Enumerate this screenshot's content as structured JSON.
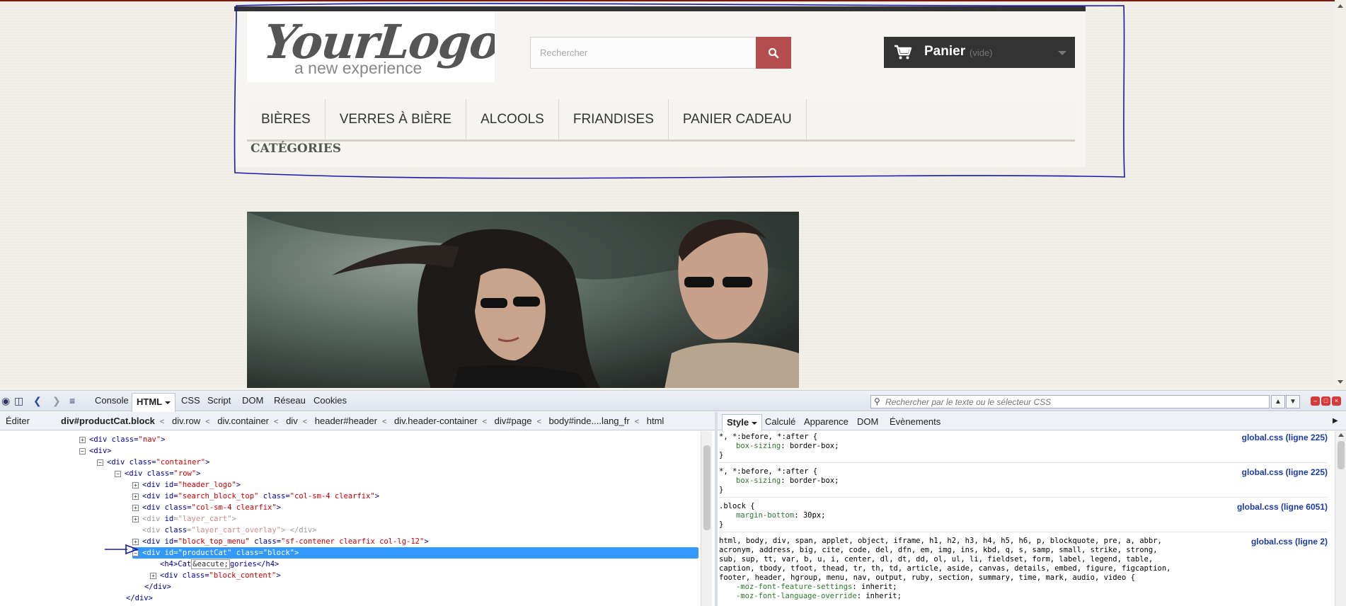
{
  "site": {
    "logo_main": "YourLogo",
    "logo_tagline": "a new experience",
    "search_placeholder": "Rechercher",
    "cart_label": "Panier",
    "cart_status": "(vide)",
    "menu": [
      "BIÈRES",
      "VERRES À BIÈRE",
      "ALCOOLS",
      "FRIANDISES",
      "PANIER CADEAU"
    ],
    "categories_title": "CATÉGORIES"
  },
  "colors": {
    "search_button": "#b44d4d",
    "cart_bg": "#333333",
    "selection": "#3399ff",
    "annotation": "#1a1aa8"
  },
  "devtools": {
    "tabs": [
      "Console",
      "HTML",
      "CSS",
      "Script",
      "DOM",
      "Réseau",
      "Cookies"
    ],
    "active_tab": "HTML",
    "css_search_placeholder": "Rechercher par le texte ou le sélecteur CSS",
    "edit_label": "Éditer",
    "breadcrumbs": [
      "div#productCat.block",
      "div.row",
      "div.container",
      "div",
      "header#header",
      "div.header-container",
      "div#page",
      "body#inde....lang_fr",
      "html"
    ],
    "style_tabs": [
      "Style",
      "Calculé",
      "Apparence",
      "DOM",
      "Évènements"
    ],
    "html_lines": [
      {
        "t1": "<div ",
        "a": "class",
        "v": "\"nav\"",
        "t2": ">"
      },
      {
        "t1": "<div>",
        "a": "",
        "v": "",
        "t2": ""
      },
      {
        "t1": "<div ",
        "a": "class",
        "v": "\"container\"",
        "t2": ">"
      },
      {
        "t1": "<div ",
        "a": "class",
        "v": "\"row\"",
        "t2": ">"
      },
      {
        "t1": "<div ",
        "a": "id",
        "v": "\"header_logo\"",
        "t2": ">"
      },
      {
        "t1": "<div ",
        "a": "id",
        "v": "\"search_block_top\"",
        "t2": "",
        "a2": "class",
        "v2": "\"col-sm-4 clearfix\"",
        "t3": ">"
      },
      {
        "t1": "<div ",
        "a": "class",
        "v": "\"col-sm-4 clearfix\"",
        "t2": ">"
      },
      {
        "t1": "<div ",
        "a": "id",
        "v": "\"layer_cart\"",
        "t2": ">"
      },
      {
        "t1": "<div ",
        "a": "class",
        "v": "\"layer_cart_overlay\"",
        "t2": "> </div>"
      },
      {
        "t1": "<div ",
        "a": "id",
        "v": "\"block_top_menu\"",
        "t2": "",
        "a2": "class",
        "v2": "\"sf-contener clearfix col-lg-12\"",
        "t3": ">"
      },
      {
        "t1": "<div ",
        "a": "id",
        "v": "\"productCat\"",
        "t2": "",
        "a2": "class",
        "v2": "\"block\"",
        "t3": ">"
      },
      {
        "t1": "<h4>Cat",
        "ent": "&eacute;",
        "t2": "gories</h4>"
      },
      {
        "t1": "<div ",
        "a": "class",
        "v": "\"block_content\"",
        "t2": ">"
      },
      {
        "t1": "</div>"
      },
      {
        "t1": "</div>"
      }
    ],
    "style_rules": [
      {
        "selector": "*, *:before, *:after {",
        "decls": [
          [
            "box-sizing",
            "border-box;"
          ]
        ],
        "source": "global.css (ligne 225)"
      },
      {
        "selector": "*, *:before, *:after {",
        "decls": [
          [
            "box-sizing",
            "border-box;"
          ]
        ],
        "source": "global.css (ligne 225)"
      },
      {
        "selector": ".block {",
        "decls": [
          [
            "margin-bottom",
            "30px;"
          ]
        ],
        "source": "global.css (ligne 6051)"
      },
      {
        "selector": "html, body, div, span, applet, object, iframe, h1, h2, h3, h4, h5, h6, p, blockquote, pre, a, abbr,\nacronym, address, big, cite, code, del, dfn, em, img, ins, kbd, q, s, samp, small, strike, strong,\nsub, sup, tt, var, b, u, i, center, dl, dt, dd, ol, ul, li, fieldset, form, label, legend, table,\ncaption, tbody, tfoot, thead, tr, th, td, article, aside, canvas, details, embed, figure, figcaption,\nfooter, header, hgroup, menu, nav, output, ruby, section, summary, time, mark, audio, video {",
        "decls": [
          [
            "-moz-font-feature-settings",
            "inherit;"
          ],
          [
            "-moz-font-language-override",
            "inherit;"
          ]
        ],
        "source": "global.css (ligne 2)"
      }
    ]
  }
}
